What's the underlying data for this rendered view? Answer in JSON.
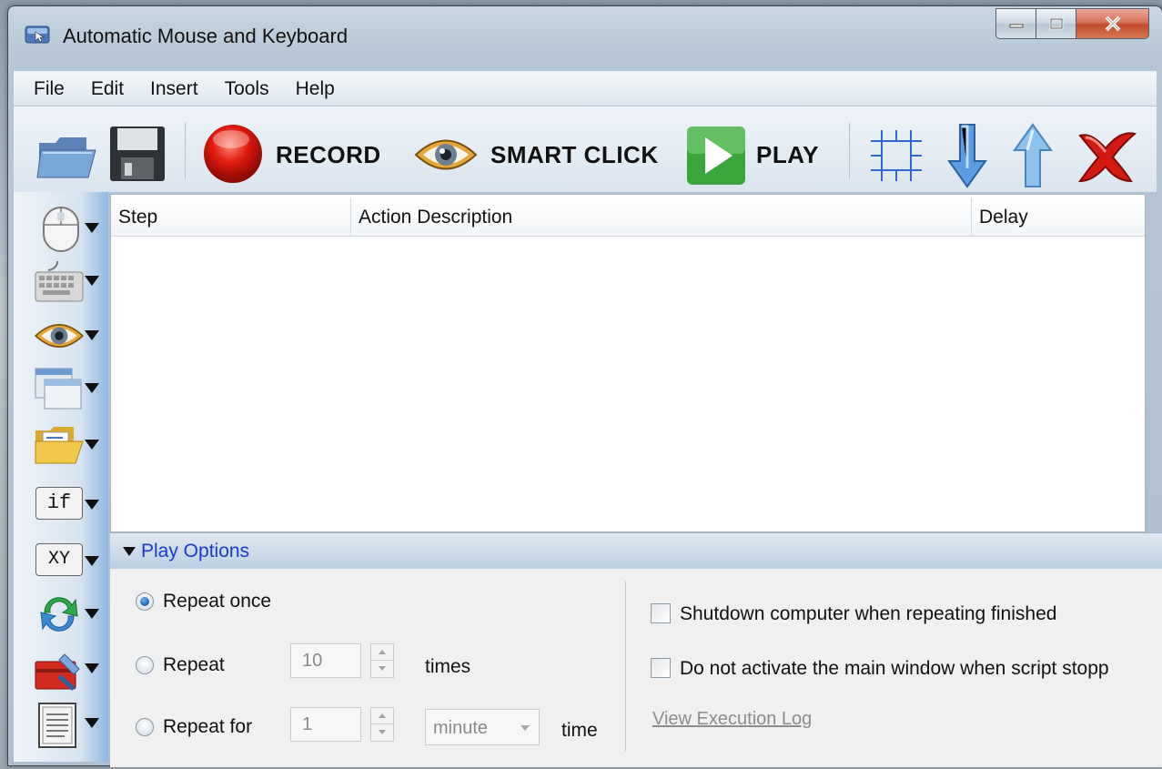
{
  "window": {
    "title": "Automatic Mouse and Keyboard",
    "controls": [
      "minimize",
      "maximize",
      "close"
    ]
  },
  "menu": [
    "File",
    "Edit",
    "Insert",
    "Tools",
    "Help"
  ],
  "toolbar": {
    "record_label": "RECORD",
    "smart_click_label": "SMART CLICK",
    "play_label": "PLAY",
    "icons": [
      "open-folder-icon",
      "save-icon",
      "record-icon",
      "eye-icon",
      "play-icon",
      "select-area-icon",
      "move-down-icon",
      "move-up-icon",
      "delete-icon"
    ]
  },
  "left_panel": {
    "items": [
      "mouse",
      "keyboard",
      "smart-click",
      "window",
      "file",
      "if",
      "XY",
      "repeat",
      "tools",
      "script"
    ],
    "if_text": "if",
    "xy_text": "XY"
  },
  "table": {
    "columns": [
      "Step",
      "Action Description",
      "Delay"
    ],
    "rows": []
  },
  "play_options": {
    "title": "Play Options",
    "repeat_once": "Repeat once",
    "repeat": "Repeat",
    "repeat_count": "10",
    "times": "times",
    "repeat_for": "Repeat for",
    "repeat_for_value": "1",
    "unit": "minute",
    "time": "time",
    "selected": "repeat_once",
    "shutdown": "Shutdown computer when repeating finished",
    "no_activate": "Do not activate the main window when script stopp",
    "view_log": "View Execution Log"
  },
  "colors": {
    "accent_blue": "#1a3ad0",
    "close_red": "#c24a2e"
  }
}
